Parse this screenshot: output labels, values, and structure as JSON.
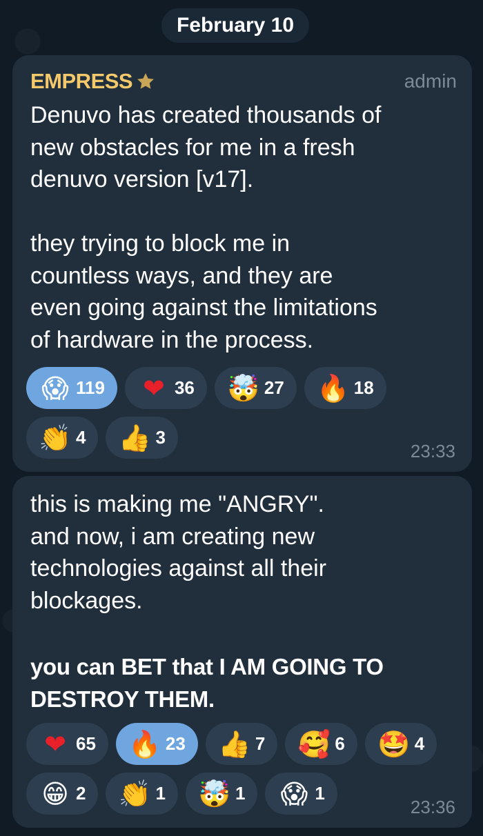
{
  "date_label": "February 10",
  "messages": [
    {
      "author": "EMPRESS",
      "author_badge_icon": "star-icon",
      "role": "admin",
      "text": "Denuvo has created thousands of\nnew obstacles for me in a fresh\ndenuvo version [v17].\n\nthey trying to block me in\ncountless ways, and they are\neven going against the limitations\nof hardware in the process.",
      "reactions": [
        {
          "emoji": "😱",
          "icon": "scream-emoji-icon",
          "count": "119",
          "active": true
        },
        {
          "emoji": "❤",
          "icon": "heart-emoji-icon",
          "count": "36",
          "active": false
        },
        {
          "emoji": "🤯",
          "icon": "exploding-head-emoji-icon",
          "count": "27",
          "active": false
        },
        {
          "emoji": "🔥",
          "icon": "fire-emoji-icon",
          "count": "18",
          "active": false
        },
        {
          "emoji": "👏",
          "icon": "clap-emoji-icon",
          "count": "4",
          "active": false
        },
        {
          "emoji": "👍",
          "icon": "thumbs-up-emoji-icon",
          "count": "3",
          "active": false
        }
      ],
      "time": "23:33"
    },
    {
      "text": "this is making me \"ANGRY\".\nand now, i am creating new\ntechnologies against all their\nblockages.",
      "bold_text": "you can BET that I AM GOING TO\nDESTROY THEM.",
      "reactions": [
        {
          "emoji": "❤",
          "icon": "heart-emoji-icon",
          "count": "65",
          "active": false
        },
        {
          "emoji": "🔥",
          "icon": "fire-emoji-icon",
          "count": "23",
          "active": true
        },
        {
          "emoji": "👍",
          "icon": "thumbs-up-emoji-icon",
          "count": "7",
          "active": false
        },
        {
          "emoji": "🥰",
          "icon": "smiling-hearts-emoji-icon",
          "count": "6",
          "active": false
        },
        {
          "emoji": "🤩",
          "icon": "star-struck-emoji-icon",
          "count": "4",
          "active": false
        },
        {
          "emoji": "😁",
          "icon": "grin-emoji-icon",
          "count": "2",
          "active": false
        },
        {
          "emoji": "👏",
          "icon": "clap-emoji-icon",
          "count": "1",
          "active": false
        },
        {
          "emoji": "🤯",
          "icon": "exploding-head-emoji-icon",
          "count": "1",
          "active": false
        },
        {
          "emoji": "😱",
          "icon": "scream-emoji-icon",
          "count": "1",
          "active": false
        }
      ],
      "time": "23:36"
    }
  ],
  "colors": {
    "author": "#f3c96b",
    "bubble": "#212f3d",
    "reaction": "#2d3e50",
    "reaction_active": "#6fa6df",
    "meta": "#7c8a98"
  }
}
